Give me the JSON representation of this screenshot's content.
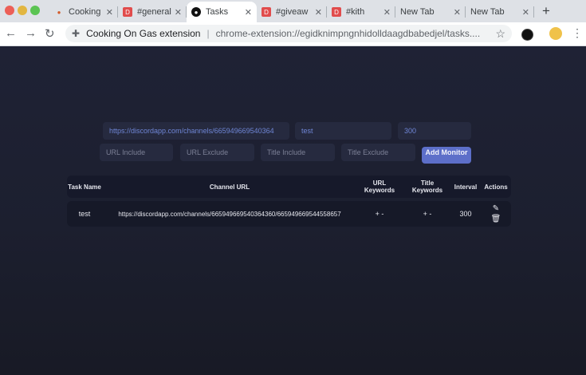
{
  "browser": {
    "tabs": [
      {
        "title": "Cooking",
        "favicon": "cooking-favicon",
        "active": false
      },
      {
        "title": "#general",
        "favicon": "discord-favicon",
        "active": false
      },
      {
        "title": "Tasks",
        "favicon": "extension-favicon",
        "active": true
      },
      {
        "title": "#giveaw",
        "favicon": "discord-favicon",
        "active": false
      },
      {
        "title": "#kith",
        "favicon": "discord-favicon",
        "active": false
      },
      {
        "title": "New Tab",
        "favicon": "",
        "active": false
      },
      {
        "title": "New Tab",
        "favicon": "",
        "active": false
      }
    ],
    "tab_close": "✕",
    "new_tab": "+",
    "omnibox": {
      "page_title": "Cooking On Gas extension",
      "url": "chrome-extension://egidknimpngnhidolldaagdbabedjel/tasks...."
    }
  },
  "form": {
    "channel_url_value": "https://discordapp.com/channels/665949669540364",
    "name_value": "test",
    "interval_value": "300",
    "url_include_placeholder": "URL Include",
    "url_exclude_placeholder": "URL Exclude",
    "title_include_placeholder": "Title Include",
    "title_exclude_placeholder": "Title Exclude",
    "add_button_label": "Add Monitor"
  },
  "table": {
    "headers": {
      "task_name": "Task Name",
      "channel_url": "Channel URL",
      "url_keywords": "URL Keywords",
      "title_keywords": "Title Keywords",
      "interval": "Interval",
      "actions": "Actions"
    },
    "rows": [
      {
        "task_name": "test",
        "channel_url": "https://discordapp.com/channels/665949669540364360/665949669544558657",
        "url_keywords": "+ -",
        "title_keywords": "+ -",
        "interval": "300"
      }
    ]
  },
  "colors": {
    "page_bg": "#1f2235",
    "field_bg": "#262a3f",
    "accent": "#5d6fc9"
  }
}
